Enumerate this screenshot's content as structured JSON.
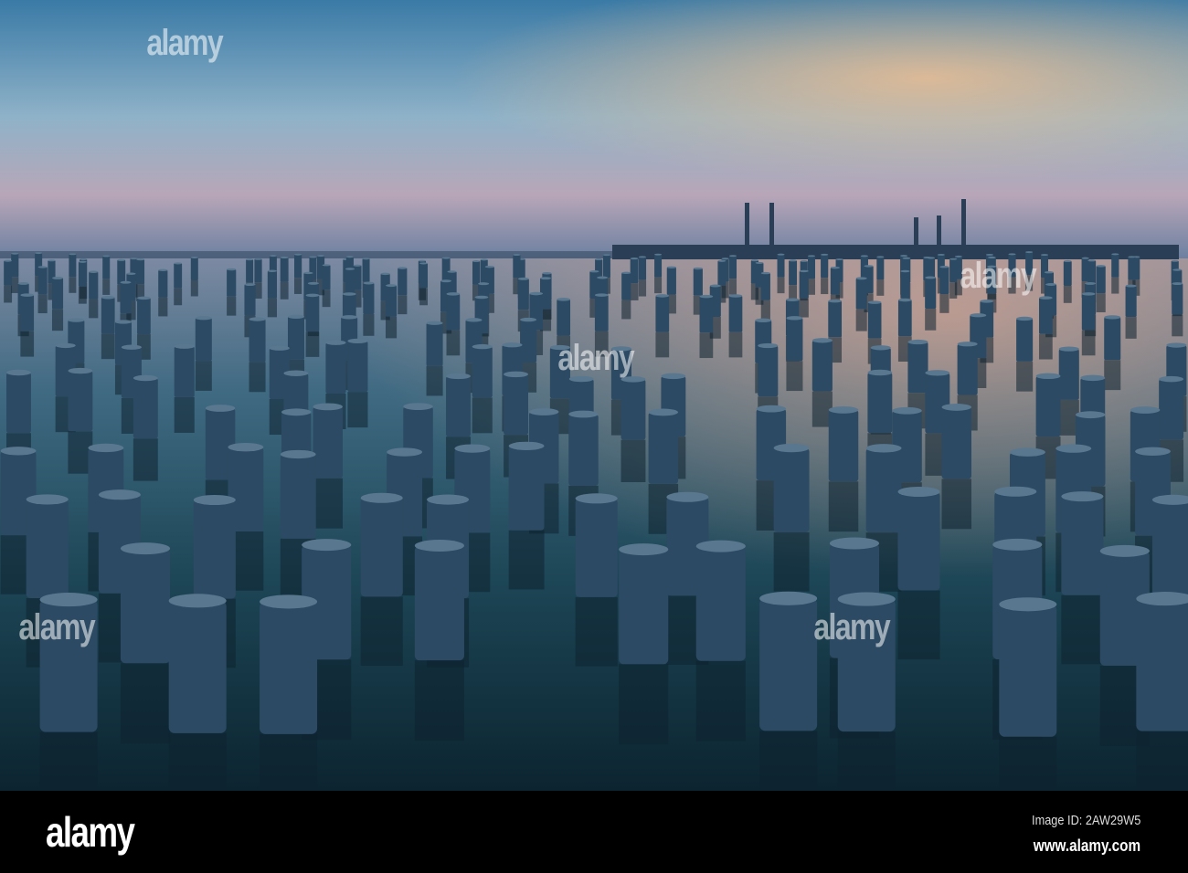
{
  "watermark": {
    "brand": "alamy"
  },
  "footer": {
    "logo": "alamy",
    "image_id": "Image ID: 2AW29W5",
    "url": "www.alamy.com"
  },
  "colors": {
    "sky_top": "#3f7fa8",
    "sky_glow": "#f2b58a",
    "water": "#12303f",
    "post": "#2c4a63"
  }
}
